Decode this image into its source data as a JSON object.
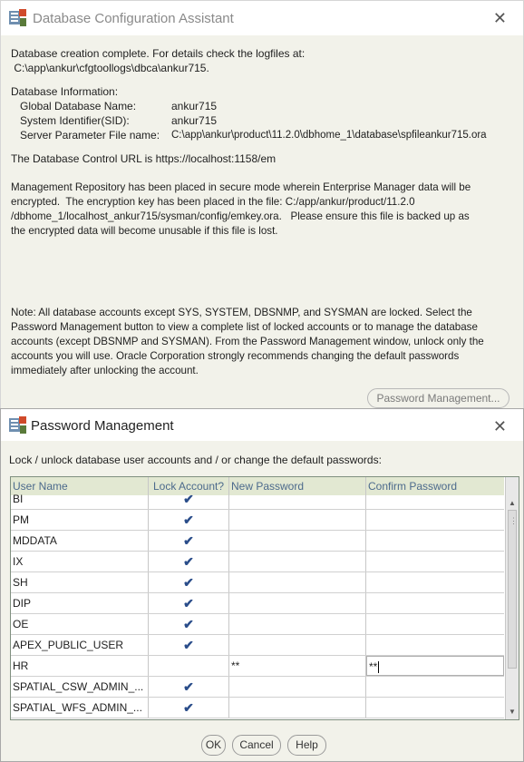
{
  "dbca": {
    "title": "Database Configuration Assistant",
    "creation_complete": "Database creation complete. For details check the logfiles at:",
    "log_path": " C:\\app\\ankur\\cfgtoollogs\\dbca\\ankur715.",
    "info_heading": "Database Information:",
    "info": [
      {
        "label": "Global Database Name:",
        "value": "ankur715"
      },
      {
        "label": "System Identifier(SID):",
        "value": "ankur715"
      },
      {
        "label": "Server Parameter File name:",
        "value": "C:\\app\\ankur\\product\\11.2.0\\dbhome_1\\database\\spfileankur715.ora"
      }
    ],
    "control_url": "The Database Control URL is https://localhost:1158/em",
    "repository_lines": [
      "Management Repository has been placed in secure mode wherein Enterprise Manager data will be",
      "encrypted.  The encryption key has been placed in the file: C:/app/ankur/product/11.2.0",
      "/dbhome_1/localhost_ankur715/sysman/config/emkey.ora.   Please ensure this file is backed up as",
      "the encrypted data will become unusable if this file is lost."
    ],
    "note_lines": [
      "Note: All database accounts except SYS, SYSTEM, DBSNMP, and SYSMAN are locked. Select the",
      "Password Management button to view a complete list of locked accounts or to manage the database",
      "accounts (except DBSNMP and SYSMAN). From the Password Management window, unlock only the",
      "accounts you will use. Oracle Corporation strongly recommends changing the default passwords",
      "immediately after unlocking the account."
    ],
    "password_button": "Password Management..."
  },
  "pwm": {
    "title": "Password Management",
    "instruction": "Lock / unlock database user accounts and / or change the default passwords:",
    "columns": [
      "User Name",
      "Lock Account?",
      "New Password",
      "Confirm Password"
    ],
    "rows": [
      {
        "user": "BI",
        "locked": true,
        "new": "",
        "confirm": ""
      },
      {
        "user": "PM",
        "locked": true,
        "new": "",
        "confirm": ""
      },
      {
        "user": "MDDATA",
        "locked": true,
        "new": "",
        "confirm": ""
      },
      {
        "user": "IX",
        "locked": true,
        "new": "",
        "confirm": ""
      },
      {
        "user": "SH",
        "locked": true,
        "new": "",
        "confirm": ""
      },
      {
        "user": "DIP",
        "locked": true,
        "new": "",
        "confirm": ""
      },
      {
        "user": "OE",
        "locked": true,
        "new": "",
        "confirm": ""
      },
      {
        "user": "APEX_PUBLIC_USER",
        "locked": true,
        "new": "",
        "confirm": ""
      },
      {
        "user": "HR",
        "locked": false,
        "new": "**",
        "confirm": "**"
      },
      {
        "user": "SPATIAL_CSW_ADMIN_...",
        "locked": true,
        "new": "",
        "confirm": ""
      },
      {
        "user": "SPATIAL_WFS_ADMIN_...",
        "locked": true,
        "new": "",
        "confirm": ""
      }
    ],
    "buttons": {
      "ok": "OK",
      "cancel": "Cancel",
      "help": "Help"
    }
  },
  "colors": {
    "window_bg": "#f2f2ea",
    "header_bg": "#e2e8d2",
    "header_text": "#4c6a8c",
    "check": "#2a4d8a"
  },
  "icons": {
    "app": "oracle-dbca-icon",
    "close": "close-icon",
    "check": "checkmark-icon"
  }
}
